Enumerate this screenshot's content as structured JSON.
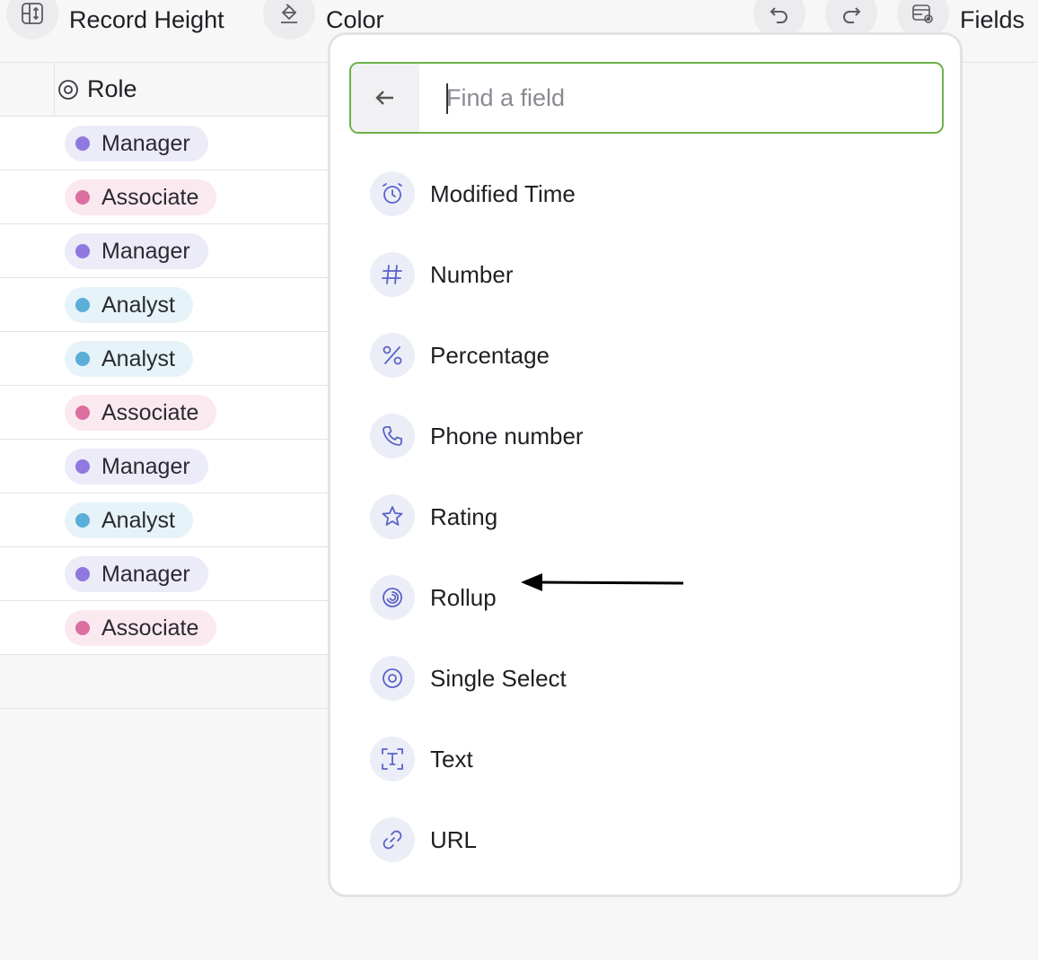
{
  "toolbar": {
    "record_height_label": "Record Height",
    "color_label": "Color",
    "fields_label": "Fields"
  },
  "table": {
    "column_header": "Role",
    "rows": [
      {
        "role": "Manager",
        "color": "#8f78e0",
        "bg": "#ecebf8"
      },
      {
        "role": "Associate",
        "color": "#dc6ea0",
        "bg": "#fbe9f0"
      },
      {
        "role": "Manager",
        "color": "#8f78e0",
        "bg": "#ecebf8"
      },
      {
        "role": "Analyst",
        "color": "#5aaed8",
        "bg": "#e6f3f9"
      },
      {
        "role": "Analyst",
        "color": "#5aaed8",
        "bg": "#e6f3f9"
      },
      {
        "role": "Associate",
        "color": "#dc6ea0",
        "bg": "#fbe9f0"
      },
      {
        "role": "Manager",
        "color": "#8f78e0",
        "bg": "#ecebf8"
      },
      {
        "role": "Analyst",
        "color": "#5aaed8",
        "bg": "#e6f3f9"
      },
      {
        "role": "Manager",
        "color": "#8f78e0",
        "bg": "#ecebf8"
      },
      {
        "role": "Associate",
        "color": "#dc6ea0",
        "bg": "#fbe9f0"
      }
    ]
  },
  "popup": {
    "search_placeholder": "Find a field",
    "fields": [
      {
        "label": "Modified Time",
        "icon": "clock-icon"
      },
      {
        "label": "Number",
        "icon": "hash-icon"
      },
      {
        "label": "Percentage",
        "icon": "percent-icon"
      },
      {
        "label": "Phone number",
        "icon": "phone-icon"
      },
      {
        "label": "Rating",
        "icon": "star-icon"
      },
      {
        "label": "Rollup",
        "icon": "spiral-icon"
      },
      {
        "label": "Single Select",
        "icon": "single-select-icon"
      },
      {
        "label": "Text",
        "icon": "text-icon"
      },
      {
        "label": "URL",
        "icon": "link-icon"
      }
    ]
  },
  "colors": {
    "accent_icon": "#5b63c9",
    "search_border": "#6cb14c"
  }
}
